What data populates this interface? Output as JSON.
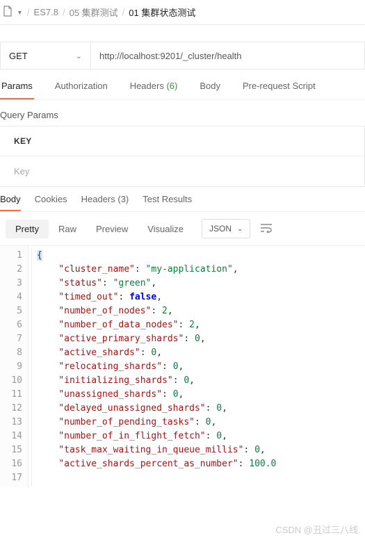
{
  "breadcrumb": {
    "c1": "ES7.8",
    "c2": "05 集群测试",
    "c3": "01 集群状态测试"
  },
  "request": {
    "method": "GET",
    "url": "http://localhost:9201/_cluster/health"
  },
  "reqtabs": {
    "params": "Params",
    "auth": "Authorization",
    "headers": "Headers",
    "headers_count": "(6)",
    "body": "Body",
    "prescript": "Pre-request Script"
  },
  "queryparams": {
    "label": "Query Params",
    "header": "KEY",
    "placeholder": "Key"
  },
  "resptabs": {
    "body": "Body",
    "cookies": "Cookies",
    "headers": "Headers",
    "headers_count": "(3)",
    "test": "Test Results"
  },
  "fmt": {
    "pretty": "Pretty",
    "raw": "Raw",
    "preview": "Preview",
    "visualize": "Visualize",
    "json": "JSON"
  },
  "json": {
    "k1": "\"cluster_name\"",
    "v1": "\"my-application\"",
    "k2": "\"status\"",
    "v2": "\"green\"",
    "k3": "\"timed_out\"",
    "v3": "false",
    "k4": "\"number_of_nodes\"",
    "v4": "2",
    "k5": "\"number_of_data_nodes\"",
    "v5": "2",
    "k6": "\"active_primary_shards\"",
    "v6": "0",
    "k7": "\"active_shards\"",
    "v7": "0",
    "k8": "\"relocating_shards\"",
    "v8": "0",
    "k9": "\"initializing_shards\"",
    "v9": "0",
    "k10": "\"unassigned_shards\"",
    "v10": "0",
    "k11": "\"delayed_unassigned_shards\"",
    "v11": "0",
    "k12": "\"number_of_pending_tasks\"",
    "v12": "0",
    "k13": "\"number_of_in_flight_fetch\"",
    "v13": "0",
    "k14": "\"task_max_waiting_in_queue_millis\"",
    "v14": "0",
    "k15": "\"active_shards_percent_as_number\"",
    "v15": "100.0"
  },
  "watermark": "CSDN @丑过三八线"
}
